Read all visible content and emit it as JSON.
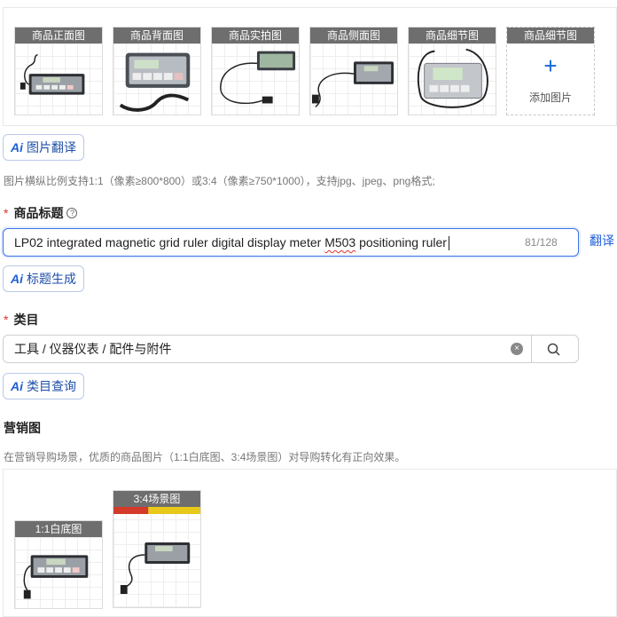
{
  "gallery": {
    "tiles": [
      {
        "label": "商品正面图",
        "icon": "meter-front-image"
      },
      {
        "label": "商品背面图",
        "icon": "meter-back-image"
      },
      {
        "label": "商品实拍图",
        "icon": "meter-real-image"
      },
      {
        "label": "商品侧面图",
        "icon": "meter-side-image"
      },
      {
        "label": "商品细节图",
        "icon": "meter-detail-image"
      }
    ],
    "add_tile": {
      "label": "商品细节图",
      "plus": "+",
      "action": "添加图片"
    }
  },
  "image_translate_button": {
    "ai": "Ai",
    "label": "图片翻译"
  },
  "image_hint": "图片横纵比例支持1:1（像素≥800*800）或3:4（像素≥750*1000），支持jpg、jpeg、png格式;",
  "title_field": {
    "required_mark": "*",
    "label": "商品标题",
    "help": "?",
    "value_parts": [
      "LP02 integrated magnetic grid ruler digital display meter ",
      "M503",
      " positioning ruler"
    ],
    "counter": "81/128",
    "translate": "翻译"
  },
  "title_generate_button": {
    "ai": "Ai",
    "label": "标题生成"
  },
  "category_field": {
    "required_mark": "*",
    "label": "类目",
    "value": "工具 / 仪器仪表 / 配件与附件",
    "clear": "×"
  },
  "category_query_button": {
    "ai": "Ai",
    "label": "类目查询"
  },
  "marketing": {
    "label": "营销图",
    "hint": "在营销导购场景，优质的商品图片（1:1白底图、3:4场景图）对导购转化有正向效果。",
    "tiles": [
      {
        "label": "1:1白底图",
        "icon": "meter-white-bg-image"
      },
      {
        "label": "3:4场景图",
        "icon": "meter-scene-image"
      }
    ]
  },
  "colors": {
    "accent": "#1f5fd6",
    "required": "#e0322b",
    "tile_header": "#6e6e6e"
  }
}
